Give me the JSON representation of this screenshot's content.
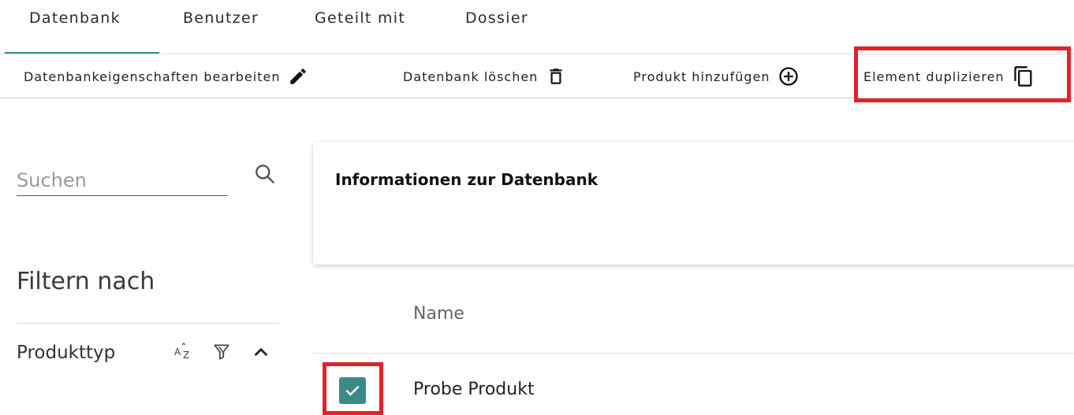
{
  "tabs": [
    {
      "label": "Datenbank",
      "active": true
    },
    {
      "label": "Benutzer"
    },
    {
      "label": "Geteilt mit"
    },
    {
      "label": "Dossier"
    }
  ],
  "toolbar": {
    "edit_label": "Datenbankeigenschaften bearbeiten",
    "edit_icon": "pencil-icon",
    "delete_label": "Datenbank löschen",
    "delete_icon": "trash-icon",
    "add_label": "Produkt hinzufügen",
    "add_icon": "plus-circle-icon",
    "duplicate_label": "Element duplizieren",
    "duplicate_icon": "copy-icon"
  },
  "sidebar": {
    "search_placeholder": "Suchen",
    "filter_title": "Filtern nach",
    "facet_label": "Produkttyp"
  },
  "info_card": {
    "title": "Informationen zur Datenbank"
  },
  "table": {
    "column_name": "Name",
    "rows": [
      {
        "name": "Probe Produkt",
        "checked": true
      }
    ]
  },
  "colors": {
    "accent": "#3a8a8a",
    "highlight": "#e4202a"
  }
}
